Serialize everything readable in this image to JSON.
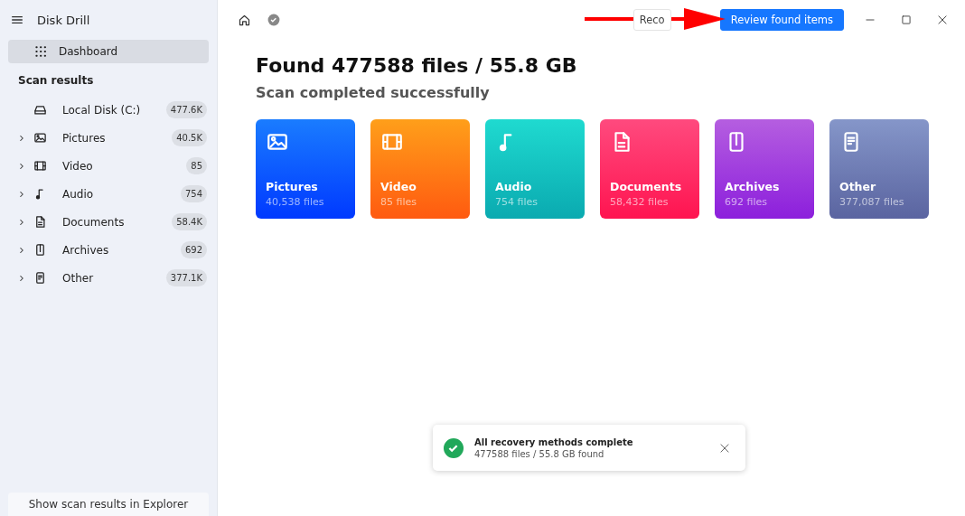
{
  "app": {
    "title": "Disk Drill"
  },
  "sidebar": {
    "items": [
      {
        "label": "Dashboard",
        "selected": true
      }
    ],
    "section": "Scan results",
    "results": [
      {
        "kind": "disk",
        "label": "Local Disk (C:)",
        "count": "477.6K",
        "expandable": false
      },
      {
        "kind": "pictures",
        "label": "Pictures",
        "count": "40.5K",
        "expandable": true
      },
      {
        "kind": "video",
        "label": "Video",
        "count": "85",
        "expandable": true
      },
      {
        "kind": "audio",
        "label": "Audio",
        "count": "754",
        "expandable": true
      },
      {
        "kind": "documents",
        "label": "Documents",
        "count": "58.4K",
        "expandable": true
      },
      {
        "kind": "archives",
        "label": "Archives",
        "count": "692",
        "expandable": true
      },
      {
        "kind": "other",
        "label": "Other",
        "count": "377.1K",
        "expandable": true
      }
    ],
    "footer_button": "Show scan results in Explorer"
  },
  "toolbar": {
    "recover_button": "Reco",
    "review_button": "Review found items"
  },
  "heading": "Found 477588 files / 55.8 GB",
  "subheading": "Scan completed successfully",
  "cards": [
    {
      "kind": "pictures",
      "title": "Pictures",
      "count": "40,538 files"
    },
    {
      "kind": "video",
      "title": "Video",
      "count": "85 files"
    },
    {
      "kind": "audio",
      "title": "Audio",
      "count": "754 files"
    },
    {
      "kind": "documents",
      "title": "Documents",
      "count": "58,432 files"
    },
    {
      "kind": "archives",
      "title": "Archives",
      "count": "692 files"
    },
    {
      "kind": "other",
      "title": "Other",
      "count": "377,087 files"
    }
  ],
  "toast": {
    "title": "All recovery methods complete",
    "message": "477588 files / 55.8 GB found"
  }
}
